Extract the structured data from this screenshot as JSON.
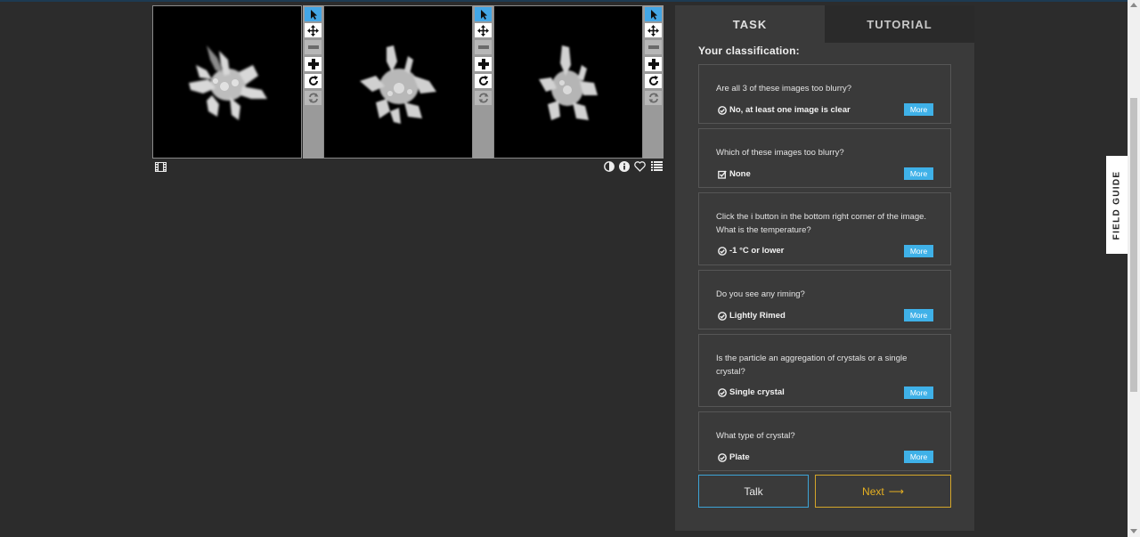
{
  "viewer": {
    "frames": [
      {
        "name": "crystal-image-1"
      },
      {
        "name": "crystal-image-2"
      },
      {
        "name": "crystal-image-3"
      }
    ],
    "tools": [
      "pointer-icon",
      "move-icon",
      "zoom-out-icon",
      "zoom-in-icon",
      "rotate-icon",
      "reset-icon"
    ],
    "bottom_icons": [
      "film-strip-icon",
      "contrast-icon",
      "info-icon",
      "heart-icon",
      "collections-icon"
    ]
  },
  "panel": {
    "tabs": [
      {
        "label": "TASK",
        "active": true
      },
      {
        "label": "TUTORIAL",
        "active": false
      }
    ],
    "heading": "Your classification:",
    "questions": [
      {
        "question": "Are all 3 of these images too blurry?",
        "answer": "No, at least one image is clear",
        "icon": "radio-check-icon",
        "more": "More"
      },
      {
        "question": "Which of these images too blurry?",
        "answer": "None",
        "icon": "checkbox-check-icon",
        "more": "More"
      },
      {
        "question": "Click the i button in the bottom right corner of the image. What is the temperature?",
        "answer": "-1 °C or lower",
        "icon": "radio-check-icon",
        "more": "More"
      },
      {
        "question": "Do you see any riming?",
        "answer": "Lightly Rimed",
        "icon": "radio-check-icon",
        "more": "More"
      },
      {
        "question": "Is the particle an aggregation of crystals or a single crystal?",
        "answer": "Single crystal",
        "icon": "radio-check-icon",
        "more": "More"
      },
      {
        "question": "What type of crystal?",
        "answer": "Plate",
        "icon": "radio-check-icon",
        "more": "More"
      }
    ],
    "talk_label": "Talk",
    "next_label": "Next",
    "next_arrow": "⟶"
  },
  "field_guide": {
    "label": "FIELD GUIDE"
  },
  "colors": {
    "accent_blue": "#3fb1e8",
    "next_gold": "#e6b021",
    "background": "#2c2c2c",
    "panel": "#3a3a3a"
  }
}
